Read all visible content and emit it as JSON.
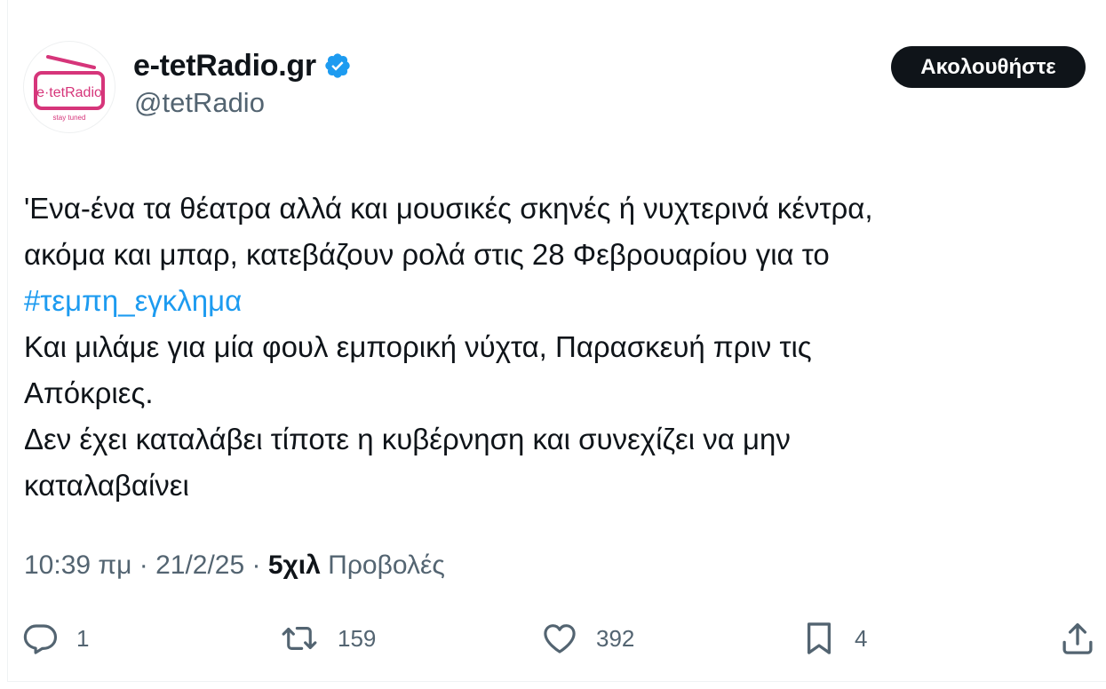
{
  "author": {
    "avatar_text": "e·tetRadio",
    "avatar_tagline": "stay tuned",
    "display_name": "e-tetRadio.gr",
    "handle": "@tetRadio",
    "verified": true
  },
  "follow_label": "Ακολουθήστε",
  "tweet": {
    "lines": [
      "'Ενα-ένα τα θέατρα αλλά και μουσικές σκηνές ή νυχτερινά κέντρα,",
      "ακόμα και μπαρ, κατεβάζουν ρολά στις 28 Φεβρουαρίου για το",
      "#τεμπη_εγκλημα",
      "Και μιλάμε για μία φουλ εμπορική νύχτα, Παρασκευή πριν τις",
      "Απόκριες.",
      "Δεν έχει καταλάβει τίποτε η κυβέρνηση και συνεχίζει να μην",
      "καταλαβαίνει"
    ]
  },
  "meta": {
    "time": "10:39 πμ",
    "separator": " · ",
    "date": "21/2/25",
    "views_count": "5χιλ",
    "views_label": " Προβολές"
  },
  "actions": {
    "replies": "1",
    "reposts": "159",
    "likes": "392",
    "bookmarks": "4"
  },
  "colors": {
    "accent": "#1d9bf0",
    "text": "#0f1419",
    "muted": "#536471",
    "brand_pink": "#d6357a"
  },
  "icons": [
    "verified-badge-icon",
    "reply-icon",
    "repost-icon",
    "like-icon",
    "bookmark-icon",
    "share-icon"
  ]
}
